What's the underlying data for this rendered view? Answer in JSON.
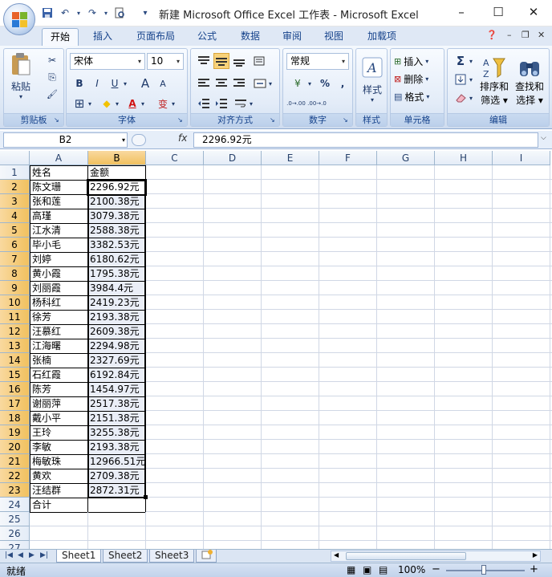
{
  "window": {
    "title": "新建 Microsoft Office Excel 工作表 - Microsoft Excel",
    "minimize": "–",
    "maximize": "☐",
    "close": "✕"
  },
  "quick_access": {
    "save": "💾",
    "undo": "↶",
    "redo": "↷",
    "preview": "⎙",
    "more": "▾"
  },
  "tabs": [
    "开始",
    "插入",
    "页面布局",
    "公式",
    "数据",
    "审阅",
    "视图",
    "加载项"
  ],
  "active_tab": "开始",
  "ribbon": {
    "clipboard": {
      "label": "剪贴板",
      "paste": "粘贴",
      "cut": "✂",
      "copy": "⎘",
      "format_painter": "🖌"
    },
    "font": {
      "label": "字体",
      "font_name": "宋体",
      "font_size": "10",
      "bold": "B",
      "italic": "I",
      "underline": "U",
      "grow": "A",
      "shrink": "A",
      "border": "⊞",
      "fill": "◆",
      "color": "A",
      "phonetic": "变"
    },
    "alignment": {
      "label": "对齐方式"
    },
    "number": {
      "label": "数字",
      "format": "常规",
      "currency": "¥",
      "percent": "%",
      "comma": ",",
      "inc_decimal": ".0→.00",
      "dec_decimal": ".00→.0"
    },
    "styles": {
      "label": "样式",
      "styles_btn": "样式"
    },
    "cells": {
      "label": "单元格",
      "insert": "插入",
      "delete": "删除",
      "format": "格式"
    },
    "editing": {
      "label": "编辑",
      "sum": "Σ",
      "sort_filter_1": "排序和",
      "sort_filter_2": "筛选",
      "find_select_1": "查找和",
      "find_select_2": "选择"
    }
  },
  "formula_bar": {
    "name_box": "B2",
    "fx": "fx",
    "content": "2296.92元"
  },
  "columns": [
    "A",
    "B",
    "C",
    "D",
    "E",
    "F",
    "G",
    "H",
    "I"
  ],
  "selected_column": "B",
  "rows": [
    {
      "n": "1",
      "a": "姓名",
      "b": "金额"
    },
    {
      "n": "2",
      "a": "陈文珊",
      "b": "2296.92元"
    },
    {
      "n": "3",
      "a": "张和莲",
      "b": "2100.38元"
    },
    {
      "n": "4",
      "a": "高瑾",
      "b": "3079.38元"
    },
    {
      "n": "5",
      "a": "江水清",
      "b": "2588.38元"
    },
    {
      "n": "6",
      "a": "毕小毛",
      "b": "3382.53元"
    },
    {
      "n": "7",
      "a": "刘婷",
      "b": "6180.62元"
    },
    {
      "n": "8",
      "a": "黄小霞",
      "b": "1795.38元"
    },
    {
      "n": "9",
      "a": "刘丽霞",
      "b": "3984.4元"
    },
    {
      "n": "10",
      "a": "杨科红",
      "b": "2419.23元"
    },
    {
      "n": "11",
      "a": "徐芳",
      "b": "2193.38元"
    },
    {
      "n": "12",
      "a": "汪慕红",
      "b": "2609.38元"
    },
    {
      "n": "13",
      "a": "江海曙",
      "b": "2294.98元"
    },
    {
      "n": "14",
      "a": "张楠",
      "b": "2327.69元"
    },
    {
      "n": "15",
      "a": "石红霞",
      "b": "6192.84元"
    },
    {
      "n": "16",
      "a": "陈芳",
      "b": "1454.97元"
    },
    {
      "n": "17",
      "a": "谢丽萍",
      "b": "2517.38元"
    },
    {
      "n": "18",
      "a": "戴小平",
      "b": "2151.38元"
    },
    {
      "n": "19",
      "a": "王玲",
      "b": "3255.38元"
    },
    {
      "n": "20",
      "a": "李敏",
      "b": "2193.38元"
    },
    {
      "n": "21",
      "a": "梅敏珠",
      "b": "12966.51元"
    },
    {
      "n": "22",
      "a": "黄欢",
      "b": "2709.38元"
    },
    {
      "n": "23",
      "a": "汪结群",
      "b": "2872.31元"
    },
    {
      "n": "24",
      "a": "合计",
      "b": ""
    },
    {
      "n": "25",
      "a": "",
      "b": ""
    },
    {
      "n": "26",
      "a": "",
      "b": ""
    },
    {
      "n": "27",
      "a": "",
      "b": ""
    }
  ],
  "sheets": [
    "Sheet1",
    "Sheet2",
    "Sheet3"
  ],
  "active_sheet": "Sheet1",
  "status": {
    "ready": "就绪",
    "zoom": "100%",
    "zoom_out": "−",
    "zoom_in": "+"
  },
  "colors": {
    "accent": "#15428b",
    "selected_header": "#f1c15f",
    "ribbon_bg": "#dbe6f4"
  }
}
